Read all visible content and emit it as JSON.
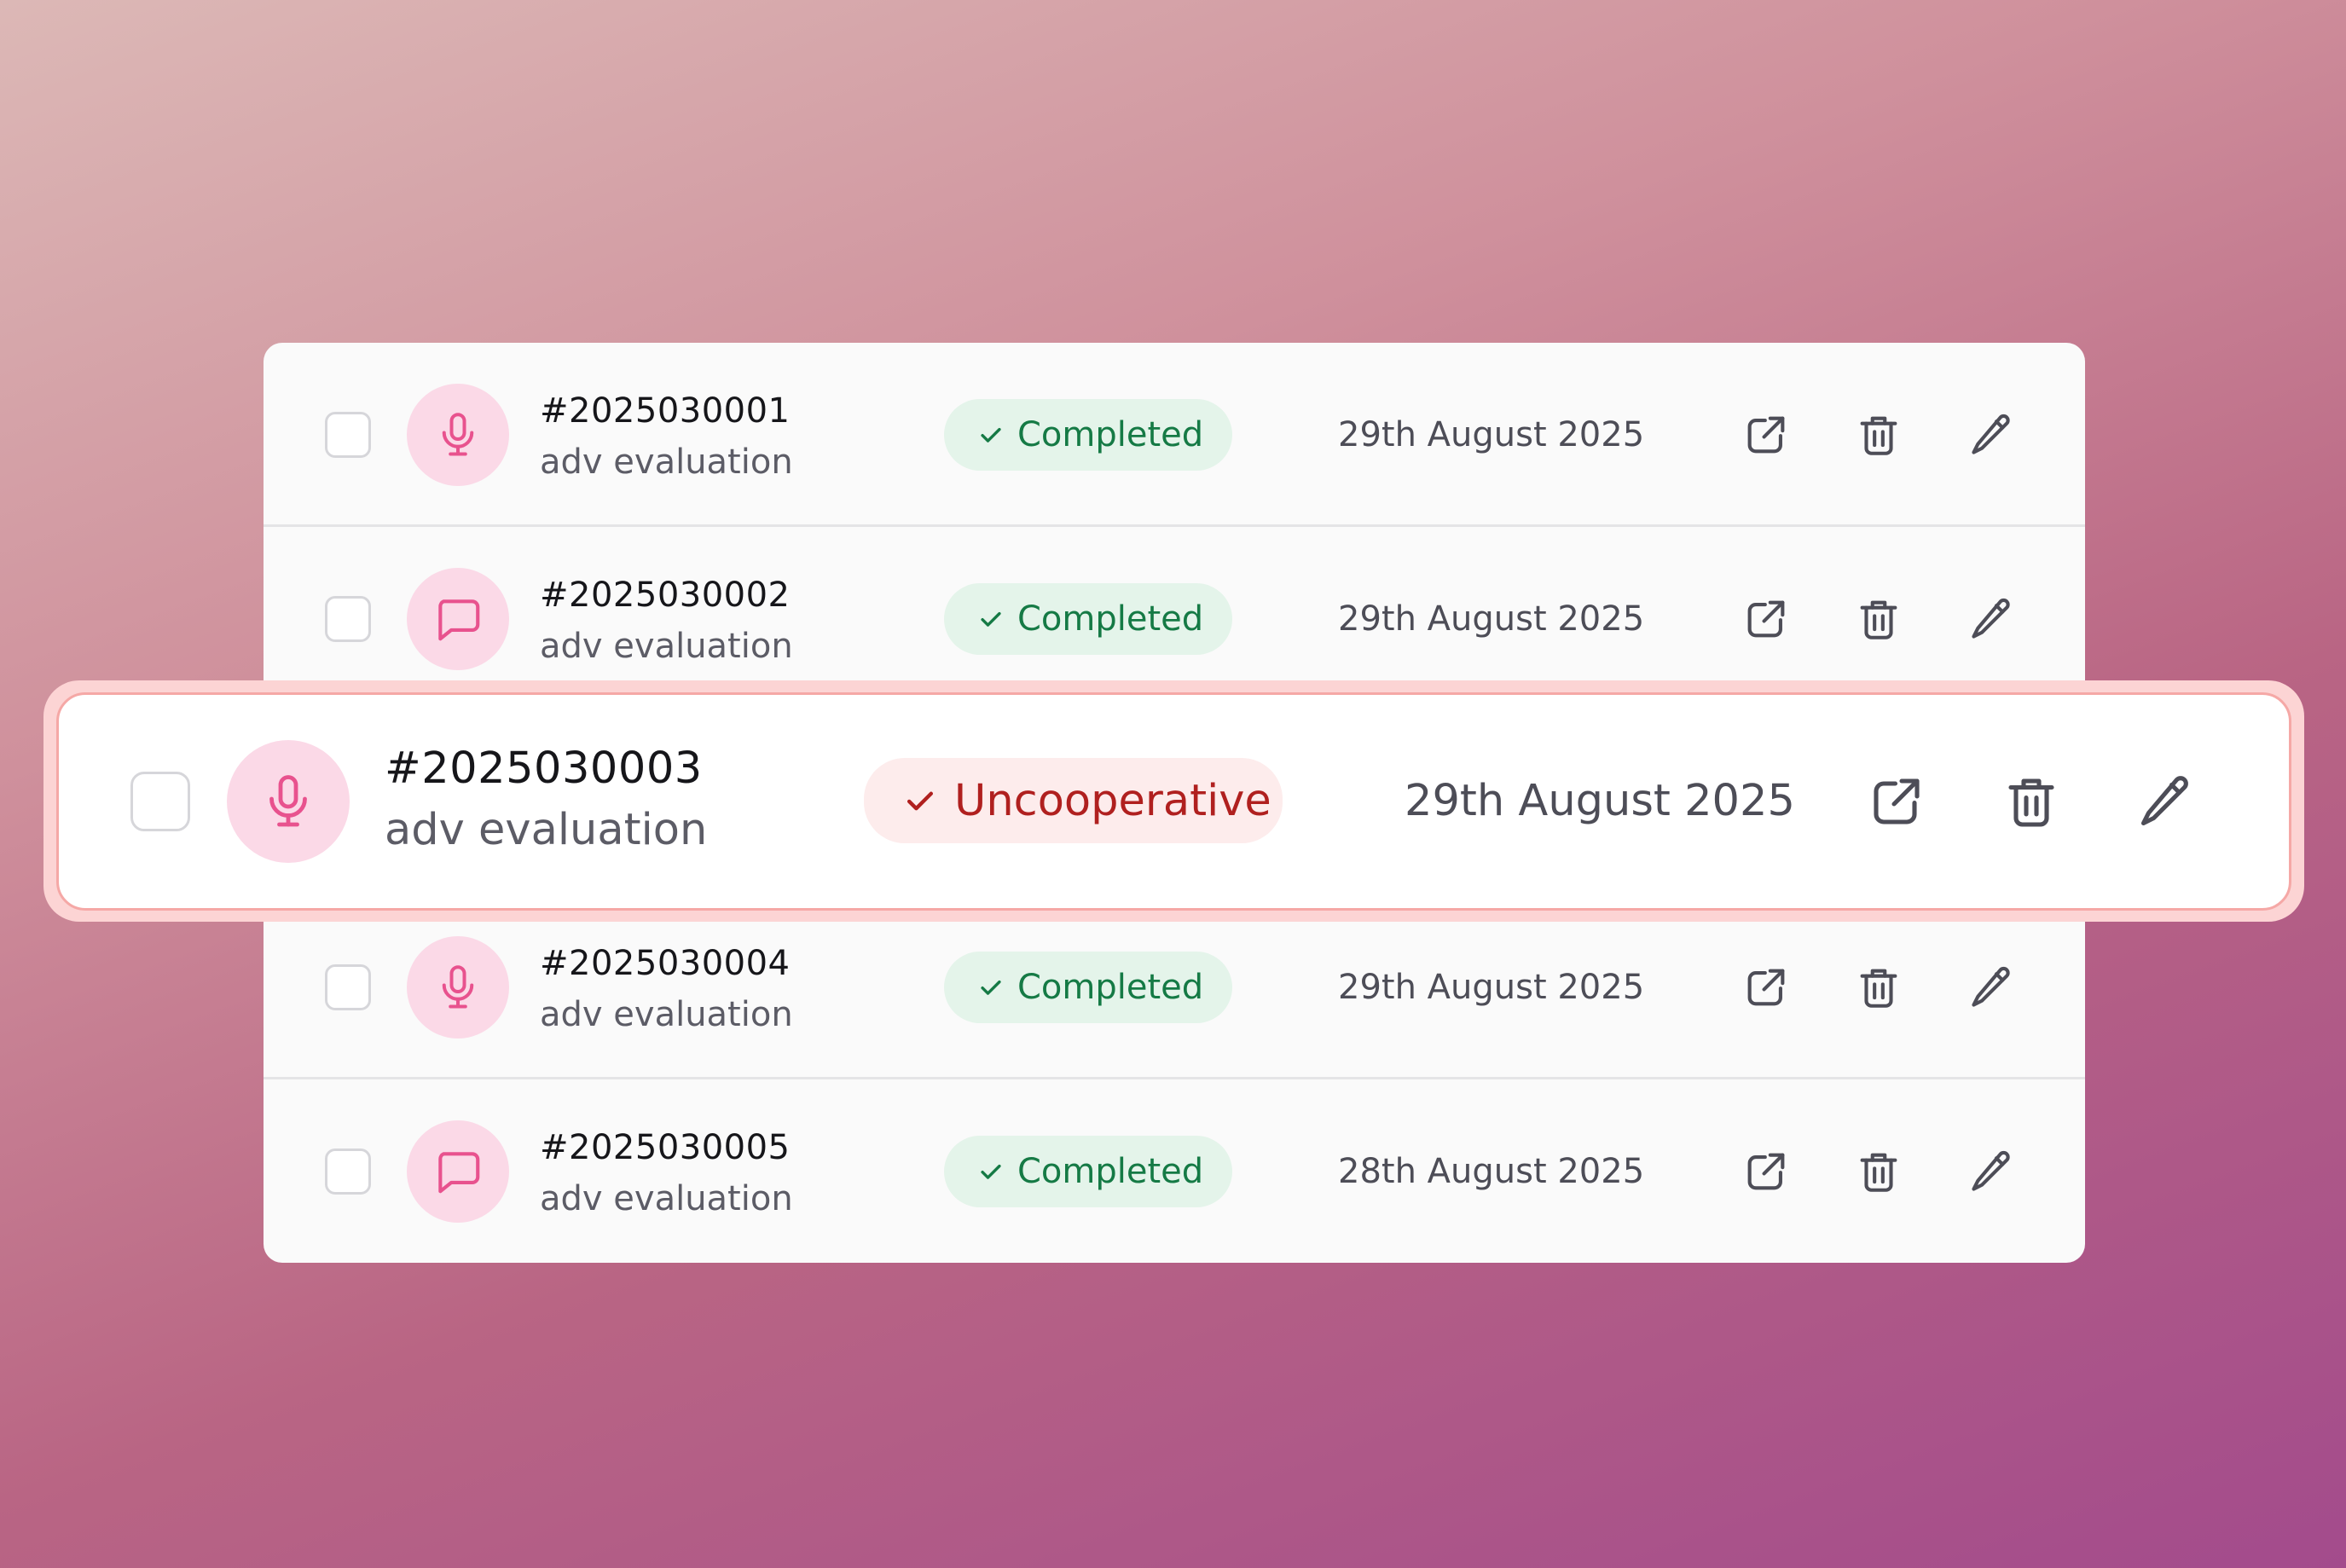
{
  "colors": {
    "completed_text": "#157a45",
    "completed_bg": "#e4f4ea",
    "uncooperative_text": "#b0201f",
    "uncooperative_bg": "#fdecec",
    "icon_accent": "#e8528e",
    "icon_circle_bg": "#fbd9e7",
    "action_icon": "#4d4d57"
  },
  "rows": [
    {
      "id": "#2025030001",
      "subtitle": "adv evaluation",
      "type_icon": "microphone-icon",
      "status": "Completed",
      "status_icon": "check-icon",
      "date": "29th August 2025"
    },
    {
      "id": "#2025030002",
      "subtitle": "adv evaluation",
      "type_icon": "chat-bubble-icon",
      "status": "Completed",
      "status_icon": "check-icon",
      "date": "29th August 2025"
    },
    {
      "id": "#2025030004",
      "subtitle": "adv evaluation",
      "type_icon": "microphone-icon",
      "status": "Completed",
      "status_icon": "check-icon",
      "date": "29th August 2025"
    },
    {
      "id": "#2025030005",
      "subtitle": "adv evaluation",
      "type_icon": "chat-bubble-icon",
      "status": "Completed",
      "status_icon": "check-icon",
      "date": "28th August 2025"
    }
  ],
  "highlighted_row": {
    "id": "#2025030003",
    "subtitle": "adv evaluation",
    "type_icon": "microphone-icon",
    "status": "Uncooperative",
    "status_icon": "check-icon",
    "date": "29th August 2025"
  },
  "action_icons": [
    "external-link-icon",
    "trash-icon",
    "pencil-icon"
  ]
}
